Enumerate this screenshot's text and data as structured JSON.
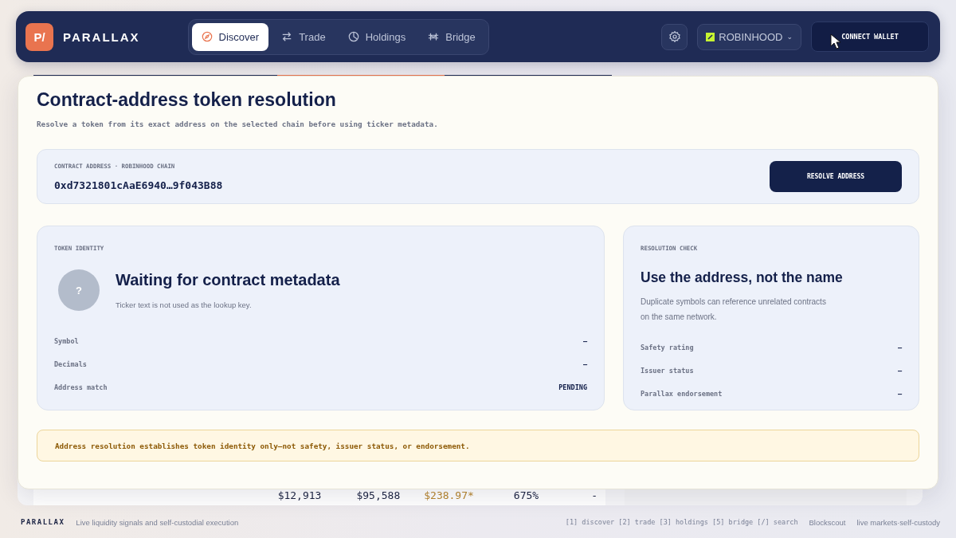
{
  "header": {
    "logo_mark": "P/",
    "brand": "PARALLAX",
    "nav": [
      {
        "label": "Discover",
        "selected": true
      },
      {
        "label": "Trade",
        "selected": false
      },
      {
        "label": "Holdings",
        "selected": false
      },
      {
        "label": "Bridge",
        "selected": false
      }
    ],
    "network": {
      "label": "ROBINHOOD",
      "caret": "⌄"
    },
    "connect_button": "CONNECT WALLET"
  },
  "background_table": {
    "rows": [
      {
        "column_2": "$12,913",
        "column_3": "$95,588",
        "column_4": "$238.97*",
        "column_5": "675%",
        "column_6": "-"
      }
    ]
  },
  "dialog": {
    "title": "Contract-address token resolution",
    "subtitle": "Resolve a token from its exact address on the selected chain before using ticker metadata.",
    "address_field": {
      "label": "CONTRACT ADDRESS · ROBINHOOD CHAIN",
      "value": "0xd7321801cAaE6940…9f043B88"
    },
    "resolve_button": "RESOLVE ADDRESS",
    "identity": {
      "label": "TOKEN IDENTITY",
      "avatar": "?",
      "title": "Waiting for contract metadata",
      "note": "Ticker text is not used as the lookup key.",
      "rows": [
        {
          "label": "Symbol",
          "value": "–"
        },
        {
          "label": "Decimals",
          "value": "–"
        },
        {
          "label": "Address match",
          "value": "PENDING"
        }
      ]
    },
    "check": {
      "label": "RESOLUTION CHECK",
      "title": "Use the address, not the name",
      "note": "Duplicate symbols can reference unrelated contracts on the same network.",
      "rows": [
        {
          "label": "Safety rating",
          "value": "–"
        },
        {
          "label": "Issuer status",
          "value": "–"
        },
        {
          "label": "Parallax endorsement",
          "value": "–"
        }
      ]
    },
    "notice": "Address resolution establishes token identity only—not safety, issuer status, or endorsement."
  },
  "footer": {
    "brand": "PARALLAX",
    "tagline": "Live liquidity signals and self-custodial execution",
    "shortcuts": "[1] discover [2] trade [3] holdings [5] bridge [/] search",
    "explorer": "Blockscout",
    "status": "live markets·self-custody"
  }
}
